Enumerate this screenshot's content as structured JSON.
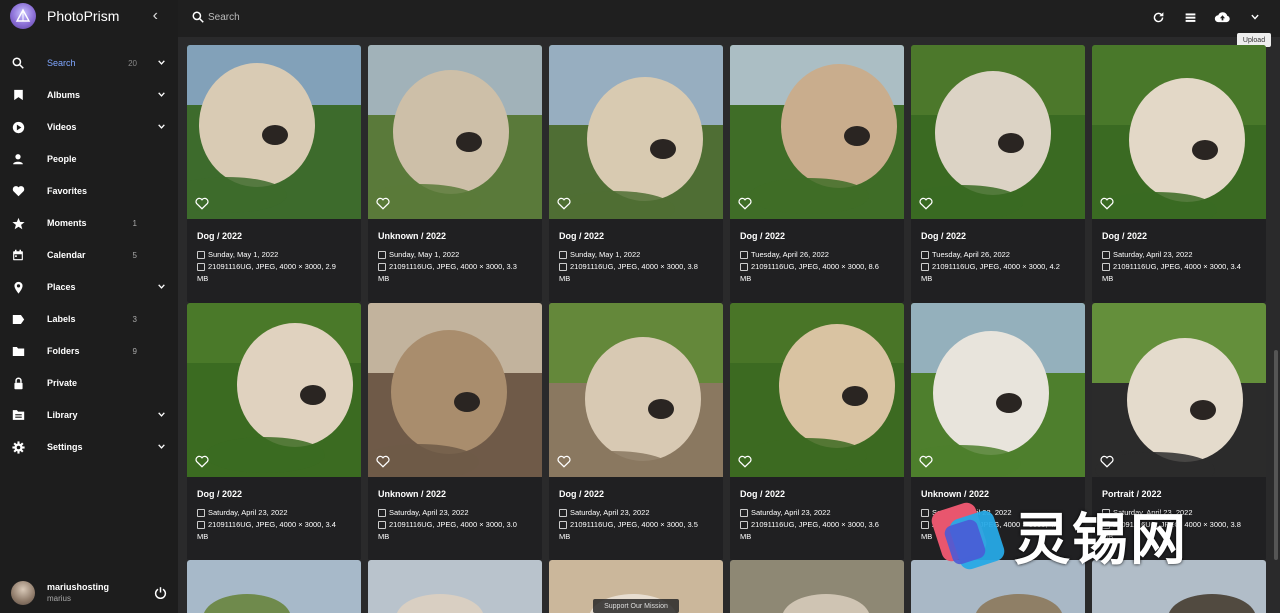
{
  "app": {
    "title": "PhotoPrism"
  },
  "sidebar": {
    "items": [
      {
        "label": "Search",
        "count": "20",
        "chevron": true,
        "icon": "search-icon",
        "active": true
      },
      {
        "label": "Albums",
        "count": "",
        "chevron": true,
        "icon": "bookmark-icon"
      },
      {
        "label": "Videos",
        "count": "",
        "chevron": true,
        "icon": "play-circle-icon"
      },
      {
        "label": "People",
        "count": "",
        "chevron": false,
        "icon": "person-icon"
      },
      {
        "label": "Favorites",
        "count": "",
        "chevron": false,
        "icon": "heart-icon"
      },
      {
        "label": "Moments",
        "count": "1",
        "chevron": false,
        "icon": "star-icon"
      },
      {
        "label": "Calendar",
        "count": "5",
        "chevron": false,
        "icon": "calendar-icon"
      },
      {
        "label": "Places",
        "count": "",
        "chevron": true,
        "icon": "map-pin-icon"
      },
      {
        "label": "Labels",
        "count": "3",
        "chevron": false,
        "icon": "label-icon"
      },
      {
        "label": "Folders",
        "count": "9",
        "chevron": false,
        "icon": "folder-icon"
      },
      {
        "label": "Private",
        "count": "",
        "chevron": false,
        "icon": "lock-icon"
      },
      {
        "label": "Library",
        "count": "",
        "chevron": true,
        "icon": "library-icon"
      },
      {
        "label": "Settings",
        "count": "",
        "chevron": true,
        "icon": "gear-icon"
      }
    ],
    "user": {
      "name": "mariushosting",
      "sub": "marius"
    }
  },
  "topbar": {
    "search_placeholder": "Search",
    "tooltip": "Upload"
  },
  "photos": [
    {
      "title": "Dog / 2022",
      "date": "Sunday, May 1, 2022",
      "file": "21091116UG, JPEG, 4000 × 3000, 2.9",
      "size": "MB",
      "colors": [
        "#8aa7c9",
        "#d9cbb4",
        "#3d6b2c"
      ]
    },
    {
      "title": "Unknown / 2022",
      "date": "Sunday, May 1, 2022",
      "file": "21091116UG, JPEG, 4000 × 3000, 3.3",
      "size": "MB",
      "colors": [
        "#a9b8c8",
        "#cdbfa8",
        "#5a7a3a"
      ]
    },
    {
      "title": "Dog / 2022",
      "date": "Sunday, May 1, 2022",
      "file": "21091116UG, JPEG, 4000 × 3000, 3.8",
      "size": "MB",
      "colors": [
        "#9fb5cf",
        "#d8cab1",
        "#4f6e34"
      ]
    },
    {
      "title": "Dog / 2022",
      "date": "Tuesday, April 26, 2022",
      "file": "21091116UG, JPEG, 4000 × 3000, 8.6",
      "size": "MB",
      "colors": [
        "#b7c7d6",
        "#c9ad8d",
        "#3f6d27"
      ]
    },
    {
      "title": "Dog / 2022",
      "date": "Tuesday, April 26, 2022",
      "file": "21091116UG, JPEG, 4000 × 3000, 4.2",
      "size": "MB",
      "colors": [
        "#4f7a2c",
        "#dcd3c5",
        "#3a6a22"
      ]
    },
    {
      "title": "Dog / 2022",
      "date": "Saturday, April 23, 2022",
      "file": "21091116UG, JPEG, 4000 × 3000, 3.4",
      "size": "MB",
      "colors": [
        "#4b7a2b",
        "#e3d8c7",
        "#3a6a22"
      ]
    },
    {
      "title": "Dog / 2022",
      "date": "Saturday, April 23, 2022",
      "file": "21091116UG, JPEG, 4000 × 3000, 3.4",
      "size": "MB",
      "colors": [
        "#4c7b2a",
        "#e0d2bf",
        "#3b6b21"
      ]
    },
    {
      "title": "Unknown / 2022",
      "date": "Saturday, April 23, 2022",
      "file": "21091116UG, JPEG, 4000 × 3000, 3.0",
      "size": "MB",
      "colors": [
        "#cbbda6",
        "#a98d6d",
        "#6f5a48"
      ]
    },
    {
      "title": "Dog / 2022",
      "date": "Saturday, April 23, 2022",
      "file": "21091116UG, JPEG, 4000 × 3000, 3.5",
      "size": "MB",
      "colors": [
        "#5f8a36",
        "#d8c9b3",
        "#8a7860"
      ]
    },
    {
      "title": "Dog / 2022",
      "date": "Saturday, April 23, 2022",
      "file": "21091116UG, JPEG, 4000 × 3000, 3.6",
      "size": "MB",
      "colors": [
        "#4a7728",
        "#d9c3a2",
        "#3c6a21"
      ]
    },
    {
      "title": "Unknown / 2022",
      "date": "Saturday, April 23, 2022",
      "file": "21091116UG, JPEG, 4000 × 3000, 4.4",
      "size": "MB",
      "colors": [
        "#9cb6cc",
        "#e8e4dc",
        "#4e7f2d"
      ]
    },
    {
      "title": "Portrait / 2022",
      "date": "Saturday, April 23, 2022",
      "file": "21091116UG, JPEG, 4000 × 3000, 3.8",
      "size": "MB",
      "colors": [
        "#6a9a3d",
        "#e4dbcc",
        "#2b2b2b"
      ]
    }
  ],
  "partial_row": [
    {
      "colors": [
        "#a7b9c9",
        "#6f8a4c"
      ]
    },
    {
      "colors": [
        "#b9c3cc",
        "#d9cfc2"
      ]
    },
    {
      "colors": [
        "#cbb79b",
        "#e7ddd0"
      ]
    },
    {
      "colors": [
        "#8e8874",
        "#cfc4b3"
      ]
    },
    {
      "colors": [
        "#a9b8c6",
        "#8f7f66"
      ]
    },
    {
      "colors": [
        "#b1bdc8",
        "#514a40"
      ]
    }
  ],
  "footer": {
    "support": "Support Our Mission"
  },
  "watermark": {
    "text": "灵锡网"
  }
}
